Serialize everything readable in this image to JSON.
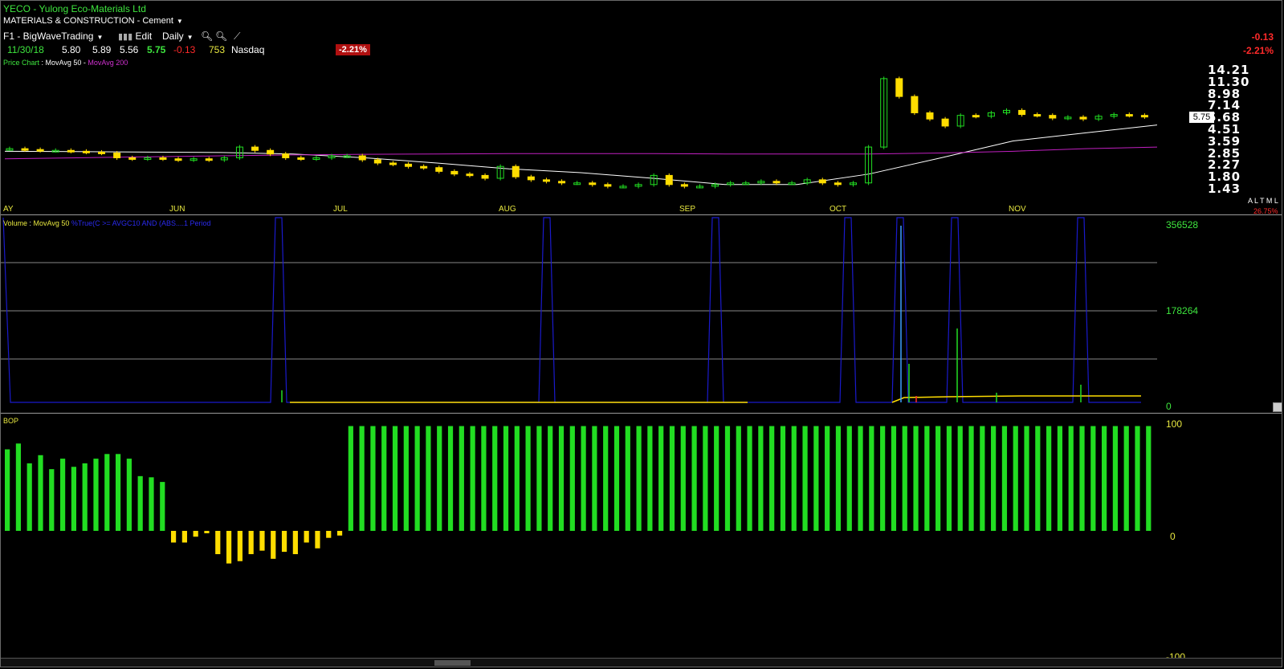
{
  "window": {
    "title": "YECO - Yulong Eco-Materials Ltd",
    "industry": "MATERIALS & CONSTRUCTION - Cement"
  },
  "toolbar": {
    "layout_name": "F1 - BigWaveTrading",
    "edit_label": "Edit",
    "period_label": "Daily"
  },
  "quote": {
    "date": "11/30/18",
    "open": "5.80",
    "high": "5.89",
    "low": "5.56",
    "close": "5.75",
    "change": "-0.13",
    "volume": "753",
    "exchange": "Nasdaq",
    "change_pct": "-2.21%"
  },
  "right_header": {
    "change": "-0.13",
    "change_pct": "-2.21%"
  },
  "price_pane": {
    "legend_name": "Price Chart",
    "legend_ma50": "MovAvg 50",
    "legend_ma200": "MovAvg 200",
    "current_price": "5.75",
    "y_ticks": [
      "14.21",
      "11.30",
      "8.98",
      "7.14",
      "5.68",
      "4.51",
      "3.59",
      "2.85",
      "2.27",
      "1.80",
      "1.43"
    ],
    "scale_buttons": "A L T M L",
    "pct_change": "26.75%",
    "months": [
      "AY",
      "JUN",
      "JUL",
      "AUG",
      "SEP",
      "OCT",
      "NOV"
    ]
  },
  "volume_pane": {
    "legend_name": "Volume",
    "legend_ma": "MovAvg 50",
    "legend_expr": "%True(C >= AVGC10 AND (ABS....1 Period",
    "y_ticks": [
      "356528",
      "178264",
      "0"
    ]
  },
  "bop_pane": {
    "legend_name": "BOP",
    "y_ticks": [
      "100",
      "0",
      "-100"
    ]
  },
  "colors": {
    "up": "#22dd22",
    "down": "#ffdd00",
    "ma50": "#ffffff",
    "ma200": "#c020c0",
    "volume_spike": "#1a1acc",
    "negative": "#ff2a2a",
    "accent_text": "#3ee53e"
  },
  "chart_data": [
    {
      "type": "candlestick",
      "title": "YECO - Yulong Eco-Materials Ltd",
      "y_scale": "log",
      "ylim": [
        1.43,
        14.21
      ],
      "x_months": [
        "JUN",
        "JUL",
        "AUG",
        "SEP",
        "OCT",
        "NOV"
      ],
      "series": [
        {
          "name": "MovAvg 50",
          "values": [
            2.95,
            2.93,
            2.9,
            2.88,
            2.8,
            2.6,
            2.35,
            2.1,
            1.95,
            1.75,
            1.55,
            1.55,
            1.9,
            2.6,
            3.6,
            4.2,
            4.9
          ]
        },
        {
          "name": "MovAvg 200",
          "values": [
            2.55,
            2.6,
            2.65,
            2.7,
            2.75,
            2.78,
            2.8,
            2.82,
            2.82,
            2.82,
            2.8,
            2.8,
            2.8,
            2.85,
            2.95,
            3.1,
            3.2
          ]
        }
      ],
      "candle_closes": [
        3.1,
        3.05,
        3.0,
        3.0,
        2.95,
        2.9,
        2.85,
        2.6,
        2.55,
        2.6,
        2.55,
        2.5,
        2.55,
        2.5,
        2.6,
        3.2,
        3.0,
        2.8,
        2.6,
        2.55,
        2.6,
        2.7,
        2.7,
        2.5,
        2.35,
        2.3,
        2.2,
        2.15,
        2.0,
        1.9,
        1.85,
        1.75,
        2.2,
        1.8,
        1.7,
        1.65,
        1.6,
        1.6,
        1.55,
        1.5,
        1.5,
        1.55,
        1.85,
        1.55,
        1.5,
        1.5,
        1.55,
        1.6,
        1.6,
        1.65,
        1.6,
        1.6,
        1.7,
        1.6,
        1.55,
        1.6,
        3.2,
        12.0,
        8.5,
        6.2,
        5.5,
        4.8,
        5.9,
        5.8,
        6.2,
        6.5,
        6.0,
        5.9,
        5.6,
        5.7,
        5.5,
        5.8,
        6.0,
        5.9,
        5.75
      ]
    },
    {
      "type": "area",
      "title": "Volume",
      "ylim": [
        0,
        356528
      ],
      "y_ticks": [
        0,
        178264,
        356528
      ],
      "series": [
        {
          "name": "Volume",
          "description_values": [
            0,
            0,
            0,
            0,
            0,
            0,
            0,
            0,
            0,
            0,
            0,
            0,
            0,
            0,
            0,
            0,
            0,
            0,
            0,
            0,
            0,
            0,
            0,
            0
          ]
        }
      ]
    },
    {
      "type": "bar",
      "title": "BOP",
      "ylim": [
        -100,
        100
      ],
      "y_ticks": [
        100,
        0,
        -100
      ],
      "values": [
        70,
        75,
        58,
        65,
        53,
        62,
        55,
        58,
        62,
        66,
        66,
        62,
        47,
        46,
        42,
        -10,
        -10,
        -5,
        0,
        -20,
        -28,
        -26,
        -20,
        -17,
        -24,
        -18,
        -20,
        -10,
        -15,
        -6,
        -4,
        90,
        90,
        90,
        90,
        90,
        90,
        90,
        90,
        90,
        90,
        90,
        90,
        90,
        90,
        90,
        90,
        90,
        90,
        90,
        90,
        90,
        90,
        90,
        90,
        90,
        90,
        90,
        90,
        90,
        90,
        90,
        90,
        90,
        90,
        90,
        90,
        90,
        90,
        90,
        90,
        90,
        90,
        90,
        90,
        90,
        90,
        90,
        90,
        90,
        90,
        90,
        90,
        90,
        90,
        90,
        90,
        90,
        90,
        90,
        90,
        90,
        90,
        90,
        90,
        90,
        90,
        90,
        90,
        90,
        90,
        90,
        90,
        90
      ]
    }
  ]
}
